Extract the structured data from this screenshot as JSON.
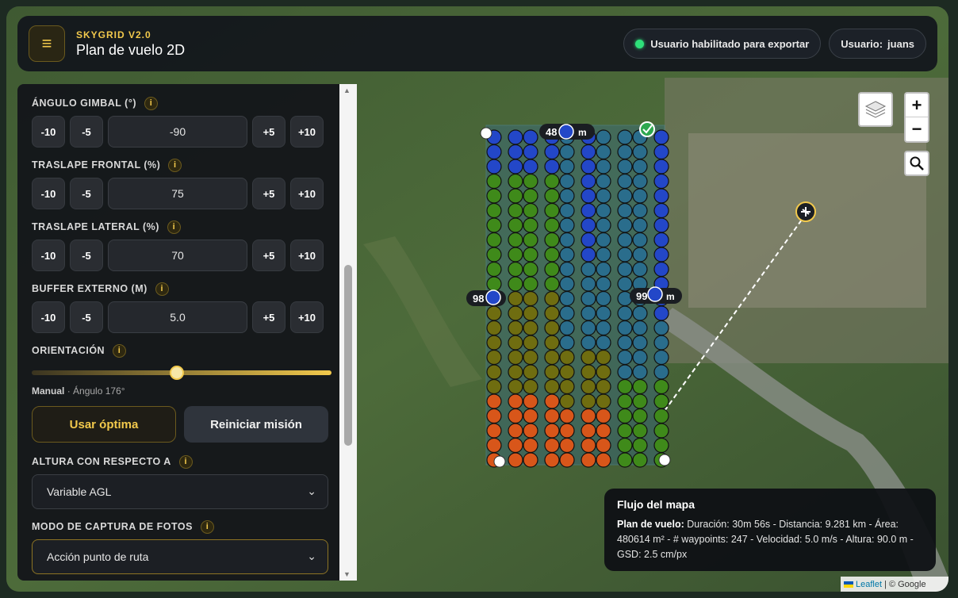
{
  "header": {
    "brand": "SKYGRID V2.0",
    "title": "Plan de vuelo 2D",
    "export_status": "Usuario habilitado para exportar",
    "user_label": "Usuario:",
    "user_name": "juans"
  },
  "panel": {
    "gimbal": {
      "label": "ÁNGULO GIMBAL (°)",
      "value": "-90"
    },
    "frontal": {
      "label": "TRASLAPE FRONTAL (%)",
      "value": "75"
    },
    "lateral": {
      "label": "TRASLAPE LATERAL (%)",
      "value": "70"
    },
    "buffer": {
      "label": "BUFFER EXTERNO (M)",
      "value": "5.0"
    },
    "steps": {
      "m10": "-10",
      "m5": "-5",
      "p5": "+5",
      "p10": "+10"
    },
    "info_glyph": "i",
    "orientation": {
      "label": "ORIENTACIÓN",
      "mode": "Manual",
      "angle_text": "· Ángulo 176°",
      "level": 0.49
    },
    "btn_optimal": "Usar óptima",
    "btn_reset": "Reiniciar misión",
    "altura": {
      "label": "ALTURA CON RESPECTO A",
      "selected": "Variable AGL"
    },
    "captura": {
      "label": "MODO DE CAPTURA DE FOTOS",
      "selected": "Acción punto de ruta"
    }
  },
  "map": {
    "edge_labels": {
      "top": "48",
      "top_unit": "m",
      "left": "98",
      "right": "99",
      "right_unit": "m"
    },
    "zoom_in": "+",
    "zoom_out": "−",
    "colors": {
      "green": "#3f8a1a",
      "blue": "#2347c8",
      "teal": "#2a6d8c",
      "olive": "#6f6d10",
      "orange": "#d8561a"
    }
  },
  "flow": {
    "title": "Flujo del mapa",
    "label": "Plan de vuelo:",
    "text": "Duración: 30m 56s - Distancia: 9.281 km - Área: 480614 m² - # waypoints: 247 - Velocidad: 5.0 m/s - Altura: 90.0 m - GSD: 2.5 cm/px"
  },
  "attribution": {
    "leaflet": "Leaflet",
    "google": "| © Google"
  }
}
